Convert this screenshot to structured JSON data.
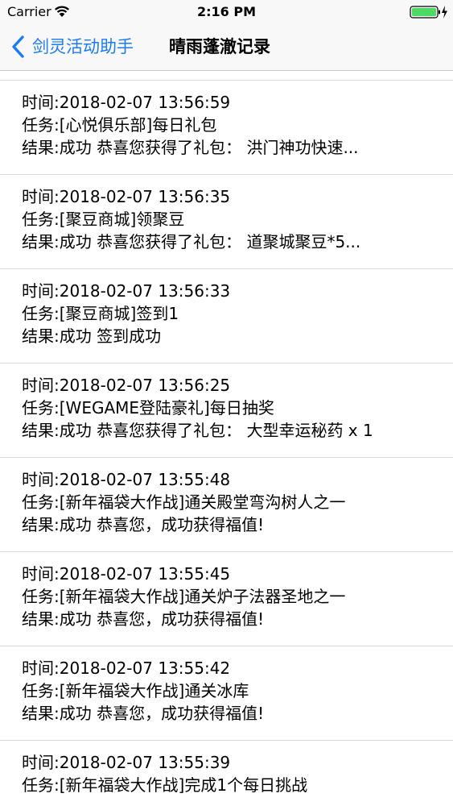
{
  "status_bar": {
    "carrier": "Carrier",
    "time": "2:16 PM"
  },
  "nav": {
    "back_label": "剑灵活动助手",
    "title": "晴雨蓬澈记录",
    "accent_color": "#1a7cf5"
  },
  "records": [
    {
      "time": "时间:2018-02-07 13:56:59",
      "task": "任务:[心悦俱乐部]每日礼包",
      "result": "结果:成功 恭喜您获得了礼包： 洪门神功快速..."
    },
    {
      "time": "时间:2018-02-07 13:56:35",
      "task": "任务:[聚豆商城]领聚豆",
      "result": "结果:成功 恭喜您获得了礼包： 道聚城聚豆*5..."
    },
    {
      "time": "时间:2018-02-07 13:56:33",
      "task": "任务:[聚豆商城]签到1",
      "result": "结果:成功 签到成功"
    },
    {
      "time": "时间:2018-02-07 13:56:25",
      "task": "任务:[WEGAME登陆豪礼]每日抽奖",
      "result": "结果:成功 恭喜您获得了礼包： 大型幸运秘药 x 1"
    },
    {
      "time": "时间:2018-02-07 13:55:48",
      "task": "任务:[新年福袋大作战]通关殿堂弯沟树人之一",
      "result": "结果:成功 恭喜您，成功获得福值!"
    },
    {
      "time": "时间:2018-02-07 13:55:45",
      "task": "任务:[新年福袋大作战]通关炉子法器圣地之一",
      "result": "结果:成功 恭喜您，成功获得福值!"
    },
    {
      "time": "时间:2018-02-07 13:55:42",
      "task": "任务:[新年福袋大作战]通关冰库",
      "result": "结果:成功 恭喜您，成功获得福值!"
    },
    {
      "time": "时间:2018-02-07 13:55:39",
      "task": "任务:[新年福袋大作战]完成1个每日挑战",
      "result": ""
    }
  ]
}
